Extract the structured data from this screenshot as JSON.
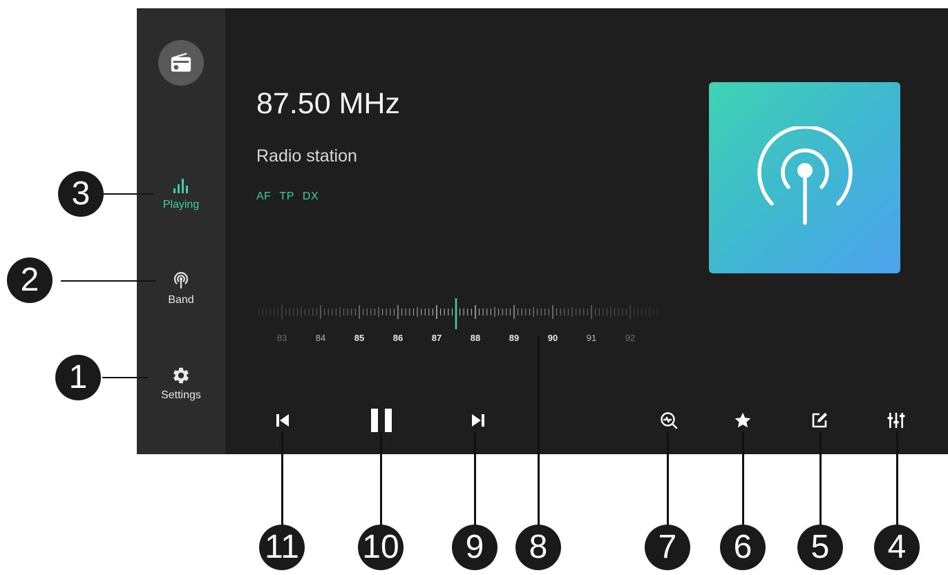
{
  "sidebar": {
    "app_icon": "radio-icon",
    "items": [
      {
        "id": "playing",
        "label": "Playing",
        "icon": "bars-icon",
        "active": true
      },
      {
        "id": "band",
        "label": "Band",
        "icon": "antenna-icon",
        "active": false
      },
      {
        "id": "settings",
        "label": "Settings",
        "icon": "gear-icon",
        "active": false
      }
    ]
  },
  "player": {
    "frequency": "87.50 MHz",
    "station": "Radio station",
    "flags": [
      "AF",
      "TP",
      "DX"
    ]
  },
  "tuner": {
    "labels": [
      "83",
      "84",
      "85",
      "86",
      "87",
      "88",
      "89",
      "90",
      "91",
      "92"
    ],
    "current": 87.5
  },
  "controls": {
    "left": [
      "previous-icon",
      "pause-icon",
      "next-icon"
    ],
    "right": [
      "scan-icon",
      "favorite-icon",
      "edit-icon",
      "equalizer-icon"
    ]
  },
  "callouts": {
    "n1": "1",
    "n2": "2",
    "n3": "3",
    "n4": "4",
    "n5": "5",
    "n6": "6",
    "n7": "7",
    "n8": "8",
    "n9": "9",
    "n10": "10",
    "n11": "11"
  },
  "colors": {
    "accent": "#3fd0a5",
    "screen": "#1e1e1e",
    "sidebar": "#2c2c2c"
  }
}
